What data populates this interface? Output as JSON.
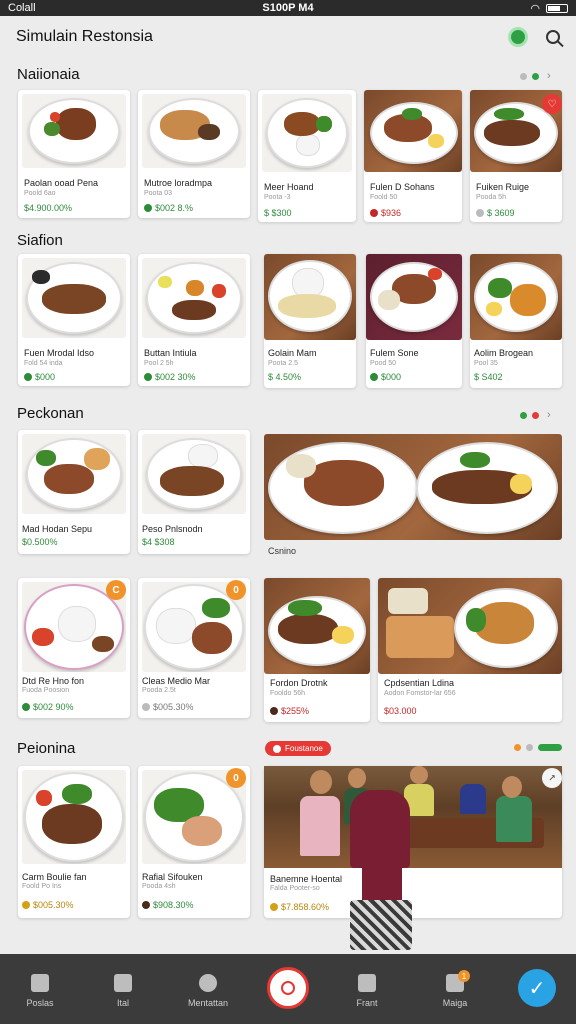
{
  "status_bar": {
    "carrier": "Colall",
    "center_text": "S100P M4",
    "wifi_icon": "wifi-icon",
    "battery_icon": "battery-icon"
  },
  "header": {
    "title": "Simulain Restonsia",
    "status_icon": "green-status-icon",
    "search_icon": "search-icon"
  },
  "sections": [
    {
      "title": "Naiionaia"
    },
    {
      "title": "Siafion"
    },
    {
      "title": "Peckonan"
    },
    {
      "title": "Peionina"
    }
  ],
  "row1": [
    {
      "title": "Paolan ooad Pena",
      "sub": "Poold 6ao",
      "price": "$4.900.00%"
    },
    {
      "title": "Mutroe loradmpa",
      "sub": "Poota 03",
      "price": "$002 8.%"
    },
    {
      "title": "Meer Hoand",
      "sub": "Poota -3",
      "price": "$ $300"
    },
    {
      "title": "Fulen D Sohans",
      "sub": "Foold 50",
      "price": "$936"
    },
    {
      "title": "Fuiken Ruige",
      "sub": "Pooda 5h",
      "price": "$ 3609"
    }
  ],
  "row2": [
    {
      "title": "Fuen Mrodal Idso",
      "sub": "Fold 54 inda",
      "price": "$000"
    },
    {
      "title": "Buttan Intiula",
      "sub": "Pool 2 5h",
      "price": "$002 30%"
    },
    {
      "title": "Golain Mam",
      "sub": "Poota 2.5",
      "price": "$ 4.50%"
    },
    {
      "title": "Fulem Sone",
      "sub": "Pood 50",
      "price": "$000"
    },
    {
      "title": "Aolim Brogean",
      "sub": "Pool 35",
      "price": "$ S402"
    }
  ],
  "row3": [
    {
      "title": "Mad Hodan Sepu",
      "price": "$0.500%"
    },
    {
      "title": "Peso Pnlsnodn",
      "price": "$4 $308"
    }
  ],
  "row3_caption": "Csnino",
  "row4": [
    {
      "title": "Dtd Re Hno fon",
      "sub": "Fuoda Poosion",
      "price": "$002 90%",
      "badge": "C"
    },
    {
      "title": "Cleas Medio Mar",
      "sub": "Pooda 2.5t",
      "price": "$005.30%",
      "badge": "0"
    },
    {
      "title": "Fordon Drotnk",
      "sub": "Fooldo 56h",
      "price": "$255%"
    },
    {
      "title": "Cpdsentian Ldina",
      "sub": "Aodon Fomstor-lar 656",
      "price": "$03.000"
    }
  ],
  "row5": [
    {
      "title": "Carm Boulie fan",
      "sub": "Foold Po Ins",
      "price": "$005.30%"
    },
    {
      "title": "Rafial Sifouken",
      "sub": "Pooda 4sh",
      "price": "$908.30%",
      "badge": "0"
    },
    {
      "title": "Banemne Hoental",
      "sub": "Falda Pooter-so",
      "price": "$7.858.60%"
    }
  ],
  "promo_label": "Foustanoe",
  "nav": [
    {
      "label": "Poslas",
      "icon": "home-icon"
    },
    {
      "label": "Ital",
      "icon": "camera-icon"
    },
    {
      "label": "Mentattan",
      "icon": "globe-icon"
    },
    {
      "label": "",
      "icon": "location-pin-icon"
    },
    {
      "label": "Frant",
      "icon": "bookmark-icon"
    },
    {
      "label": "Maiga",
      "icon": "messages-icon",
      "badge": "1"
    }
  ],
  "fab_icon": "check-icon",
  "colors": {
    "accent_green": "#2e8b3a",
    "accent_red": "#e53935",
    "badge_orange": "#f0932b",
    "fab_blue": "#29a3e3",
    "nav_bg": "#3b3b3b"
  }
}
